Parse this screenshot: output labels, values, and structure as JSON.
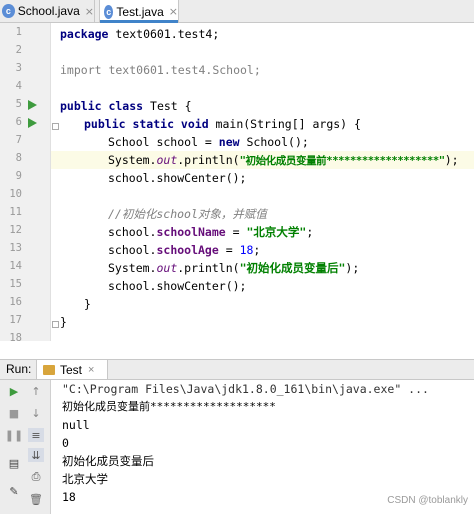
{
  "tabs": [
    {
      "label": "School.java",
      "icon": "class-icon",
      "active": false
    },
    {
      "label": "Test.java",
      "icon": "class-icon",
      "active": true
    }
  ],
  "editor": {
    "line_numbers": [
      "1",
      "2",
      "3",
      "4",
      "5",
      "6",
      "7",
      "8",
      "9",
      "10",
      "11",
      "12",
      "13",
      "14",
      "15",
      "16",
      "17",
      "18"
    ],
    "lines": {
      "l1_kw": "package",
      "l1_rest": " text0601.test4;",
      "l3": "import text0601.test4.School;",
      "l5_kw": "public class",
      "l5_rest": " Test {",
      "l6_kw": "public static void",
      "l6_rest": " main(String[] args) {",
      "l7_a": "School school = ",
      "l7_kw": "new",
      "l7_b": " School();",
      "l8_a": "System.",
      "l8_out": "out",
      "l8_b": ".println(",
      "l8_str": "\"初始化成员变量前*******************\"",
      "l8_c": ");",
      "l9": "school.showCenter();",
      "l11_cmt": "//初始化school对象，并赋值",
      "l12_a": "school.",
      "l12_fld": "schoolName",
      "l12_b": " = ",
      "l12_str": "\"北京大学\"",
      "l12_c": ";",
      "l13_a": "school.",
      "l13_fld": "schoolAge",
      "l13_b": " = ",
      "l13_num": "18",
      "l13_c": ";",
      "l14_a": "System.",
      "l14_out": "out",
      "l14_b": ".println(",
      "l14_str": "\"初始化成员变量后\"",
      "l14_c": ");",
      "l15": "school.showCenter();",
      "l16": "}",
      "l17": "}"
    }
  },
  "run_panel": {
    "label": "Run:",
    "tab_label": "Test",
    "output": [
      "\"C:\\Program Files\\Java\\jdk1.8.0_161\\bin\\java.exe\" ...",
      "初始化成员变量前*******************",
      "null",
      "0",
      "初始化成员变量后",
      "北京大学",
      "18"
    ],
    "toolbar_icons": [
      "rerun-icon",
      "up-arrow-icon",
      "stop-icon",
      "down-arrow-icon",
      "pause-icon",
      "soft-wrap-icon",
      "layout-icon",
      "scroll-to-end-icon",
      "pin-icon",
      "print-icon",
      "trash-icon"
    ]
  },
  "watermark": "CSDN @toblankly",
  "colors": {
    "keyword": "#000080",
    "string": "#008000",
    "field": "#660e7a",
    "comment": "#808080",
    "number": "#0000ff",
    "run_arrow": "#3e9b3e",
    "active_tab_underline": "#4083c9"
  }
}
